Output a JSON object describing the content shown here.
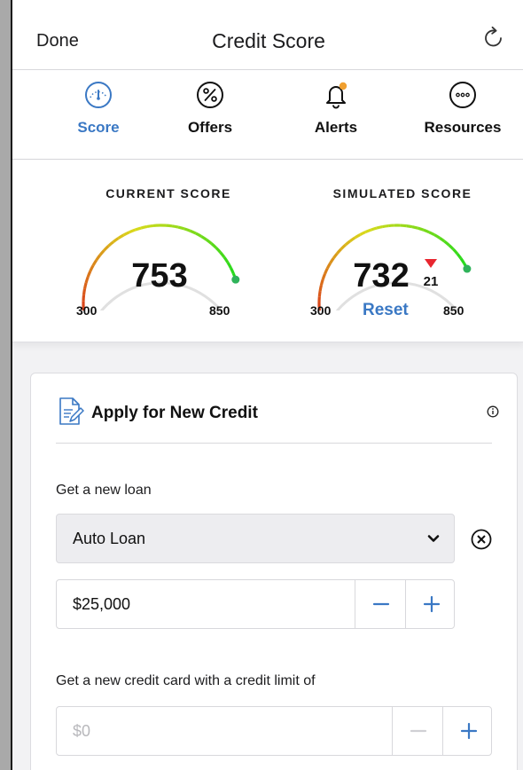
{
  "header": {
    "done_label": "Done",
    "title": "Credit Score",
    "refresh_icon": "refresh-icon"
  },
  "tabs": [
    {
      "label": "Score",
      "icon": "gauge-icon",
      "active": true
    },
    {
      "label": "Offers",
      "icon": "percent-icon",
      "active": false
    },
    {
      "label": "Alerts",
      "icon": "bell-icon",
      "active": false,
      "badge": true
    },
    {
      "label": "Resources",
      "icon": "more-icon",
      "active": false
    }
  ],
  "scores": {
    "current": {
      "caption": "CURRENT SCORE",
      "value": "753",
      "min": "300",
      "max": "850",
      "score": 753
    },
    "simulated": {
      "caption": "SIMULATED SCORE",
      "value": "732",
      "min": "300",
      "max": "850",
      "score": 732,
      "delta": "21",
      "reset_label": "Reset"
    }
  },
  "apply": {
    "title": "Apply for New Credit",
    "loan_label": "Get a new loan",
    "loan_type": "Auto Loan",
    "loan_amount": "$25,000",
    "card_label": "Get a new credit card with a credit limit of",
    "card_placeholder": "$0"
  },
  "colors": {
    "accent": "#3a78c4",
    "delta_down": "#e8262f",
    "gauge_track": "#e0e0e0",
    "gauge_marker": "#2fb35a"
  }
}
